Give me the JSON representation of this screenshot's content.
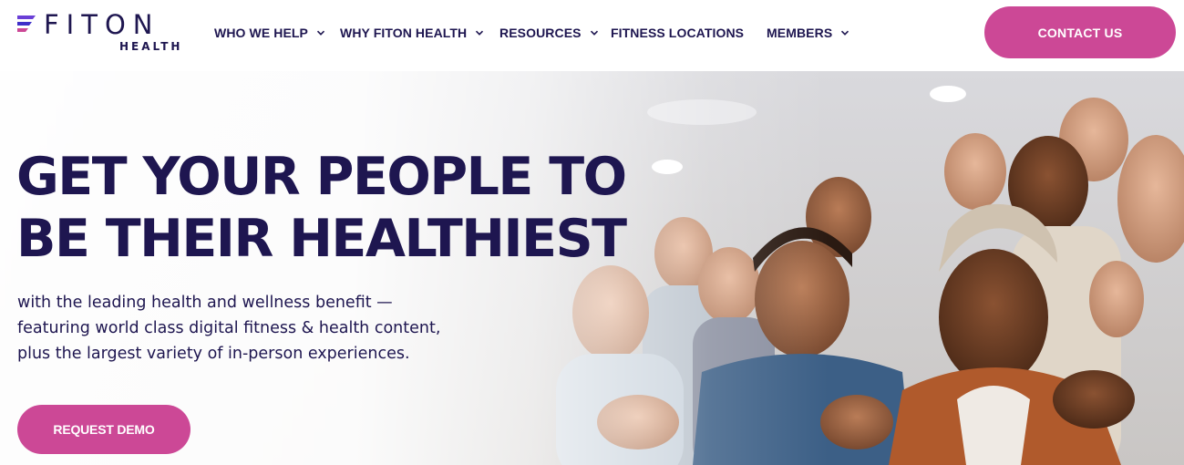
{
  "brand": {
    "wordmark": "FITON",
    "sub": "HEALTH"
  },
  "nav": {
    "items": [
      {
        "label": "WHO WE HELP",
        "has_dropdown": true
      },
      {
        "label": "WHY FITON HEALTH",
        "has_dropdown": true
      },
      {
        "label": "RESOURCES",
        "has_dropdown": true
      },
      {
        "label": "FITNESS LOCATIONS",
        "has_dropdown": false
      },
      {
        "label": "MEMBERS",
        "has_dropdown": true
      }
    ],
    "contact_label": "CONTACT US"
  },
  "hero": {
    "headline_lines": [
      "GET YOUR PEOPLE TO",
      "BE THEIR HEALTHIEST"
    ],
    "subtext_lines": [
      "with the leading health and wellness benefit —",
      "featuring world class digital fitness & health content,",
      "plus the largest variety of in-person experiences."
    ],
    "cta_label": "REQUEST DEMO"
  },
  "colors": {
    "brand_navy": "#1e1650",
    "accent_pink": "#cc4896",
    "logo_purple": "#6a3fd6"
  },
  "icons": {
    "dropdown": "chevron-down-icon",
    "logo_mark": "fiton-logo-mark-icon"
  }
}
